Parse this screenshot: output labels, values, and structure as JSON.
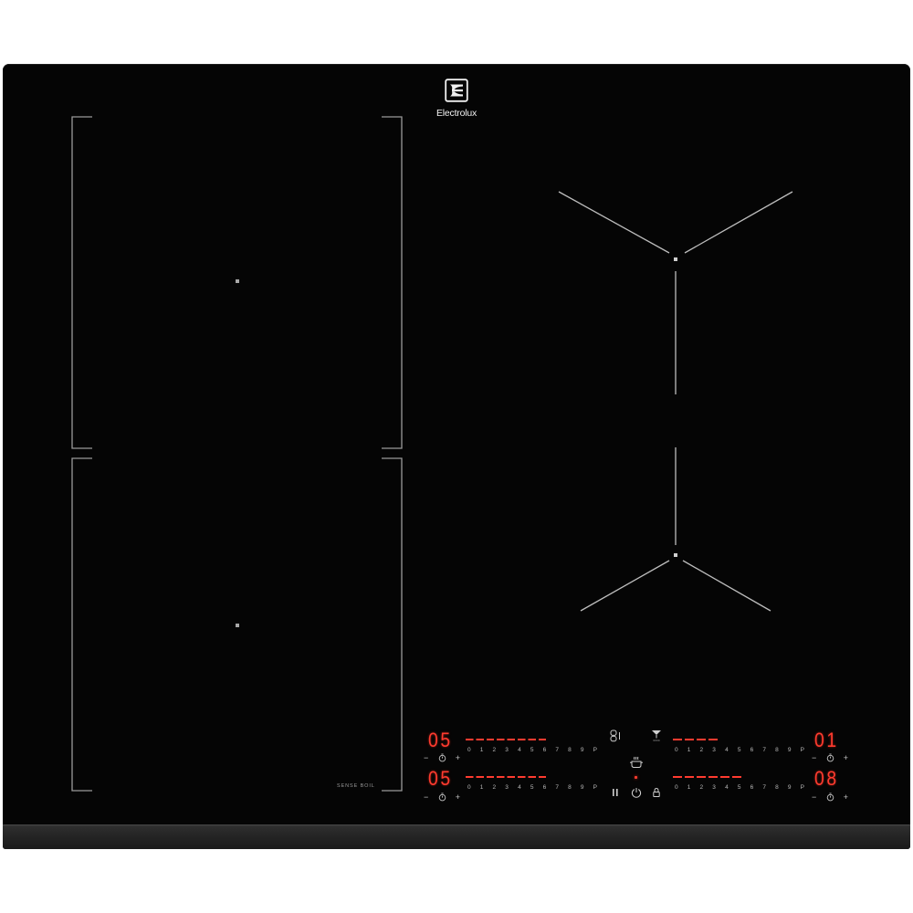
{
  "brand": {
    "name": "Electrolux",
    "logo": "electrolux-logo-icon"
  },
  "colors": {
    "glass": "#050505",
    "zone_outline": "#9a9a9a",
    "display_red": "#ff3b2f",
    "panel_icons": "#c8c8c8"
  },
  "zones": {
    "sense_boil_label": "SENSE BOIL"
  },
  "controls": {
    "scale_labels": [
      "0",
      "1",
      "2",
      "3",
      "4",
      "5",
      "6",
      "7",
      "8",
      "9",
      "P"
    ],
    "timer": {
      "minus": "−",
      "plus": "+",
      "icon": "timer-icon"
    },
    "rows": [
      {
        "left": {
          "display": "05",
          "lit_dashes": 8
        },
        "right": {
          "display": "01",
          "lit_dashes": 4
        }
      },
      {
        "left": {
          "display": "05",
          "lit_dashes": 8
        },
        "right": {
          "display": "08",
          "lit_dashes": 6
        }
      }
    ],
    "center_icons": {
      "bridge": "bridge-icon",
      "hood": "hob2hood-icon",
      "boil": "pot-icon",
      "indicator": "indicator-light",
      "pause": "pause-icon",
      "power": "power-icon",
      "lock": "lock-icon"
    }
  }
}
